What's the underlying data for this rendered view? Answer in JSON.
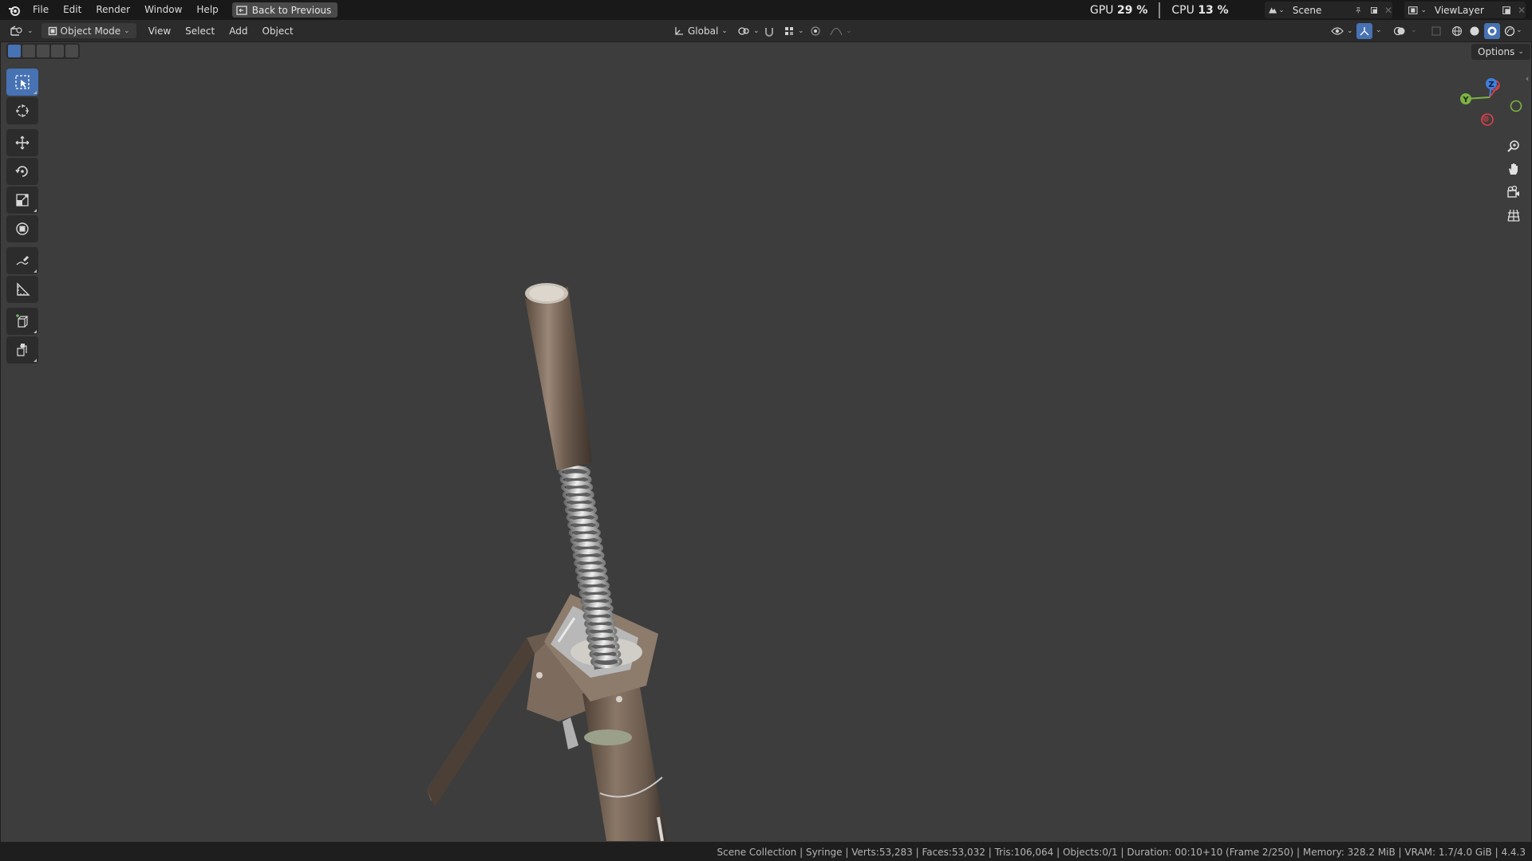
{
  "menubar": {
    "items": [
      "File",
      "Edit",
      "Render",
      "Window",
      "Help"
    ],
    "back_button": "Back to Previous",
    "gpu_label": "GPU",
    "gpu_value": "29 %",
    "cpu_label": "CPU",
    "cpu_value": "13 %",
    "scene_name": "Scene",
    "view_layer": "ViewLayer"
  },
  "viewport_header": {
    "mode": "Object Mode",
    "menus": [
      "View",
      "Select",
      "Add",
      "Object"
    ],
    "transform_orientation": "Global",
    "options_label": "Options"
  },
  "toolbar": {
    "tools": [
      "select-box",
      "cursor",
      "move",
      "rotate",
      "scale",
      "transform",
      "annotate",
      "measure",
      "add-cube",
      "extrude"
    ],
    "active_tool": "select-box"
  },
  "gizmo": {
    "axes": [
      "Z",
      "Y"
    ]
  },
  "status": {
    "text": "Scene Collection | Syringe | Verts:53,283 | Faces:53,032 | Tris:106,064 | Objects:0/1 | Duration: 00:10+10 (Frame 2/250) | Memory: 328.2 MiB | VRAM: 1.7/4.0 GiB | 4.4.3"
  },
  "colors": {
    "accent": "#4772b3",
    "viewport_bg": "#3d3d3d",
    "axis_x": "#e0404a",
    "axis_y": "#7cb342",
    "axis_z": "#3f7fdf"
  }
}
